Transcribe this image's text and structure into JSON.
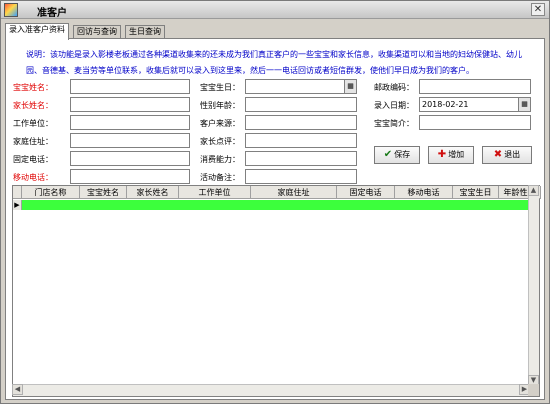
{
  "window": {
    "title": "准客户",
    "close_label": "✕"
  },
  "tabs": [
    {
      "label": "录入准客户资料"
    },
    {
      "label": "回访与查询"
    },
    {
      "label": "生日查询"
    }
  ],
  "description": "说明：该功能是录入影楼老板通过各种渠道收集来的还未成为我们真正客户的一些宝宝和家长信息，收集渠道可以和当地的妇幼保健站、幼儿园、音德基、麦当劳等单位联系，收集后就可以录入到这里来，然后一一电话回访或者短信群发，使他们早日成为我们的客户。",
  "form": {
    "baby_name": {
      "label": "宝宝姓名：",
      "value": ""
    },
    "parent_name": {
      "label": "家长姓名：",
      "value": ""
    },
    "work_unit": {
      "label": "工作单位：",
      "value": ""
    },
    "home_address": {
      "label": "家庭住址：",
      "value": ""
    },
    "home_phone": {
      "label": "固定电话：",
      "value": ""
    },
    "mobile_phone": {
      "label": "移动电话：",
      "value": ""
    },
    "baby_birthday": {
      "label": "宝宝生日：",
      "value": ""
    },
    "gender_age": {
      "label": "性别年龄：",
      "value": ""
    },
    "customer_source": {
      "label": "客户来源：",
      "value": ""
    },
    "parent_comment": {
      "label": "家长点评：",
      "value": ""
    },
    "spending_power": {
      "label": "消费能力：",
      "value": ""
    },
    "activity_note": {
      "label": "活动备注：",
      "value": ""
    },
    "postcode": {
      "label": "邮政编码：",
      "value": ""
    },
    "entry_date": {
      "label": "录入日期：",
      "value": "2018-02-21"
    },
    "baby_intro": {
      "label": "宝宝简介：",
      "value": ""
    },
    "date_button_icon": "calendar-icon"
  },
  "buttons": {
    "save": {
      "label": "保存",
      "icon": "checkmark-icon",
      "color": "#1a7a1a"
    },
    "add": {
      "label": "增加",
      "icon": "plus-icon",
      "color": "#d01010"
    },
    "exit": {
      "label": "退出",
      "icon": "x-icon",
      "color": "#d01010"
    }
  },
  "grid": {
    "columns": [
      "门店名称",
      "宝宝姓名",
      "家长姓名",
      "工作单位",
      "家庭住址",
      "固定电话",
      "移动电话",
      "宝宝生日",
      "年龄性别"
    ],
    "row_indicator": "▶",
    "selected_row_color": "#3cff3c"
  }
}
